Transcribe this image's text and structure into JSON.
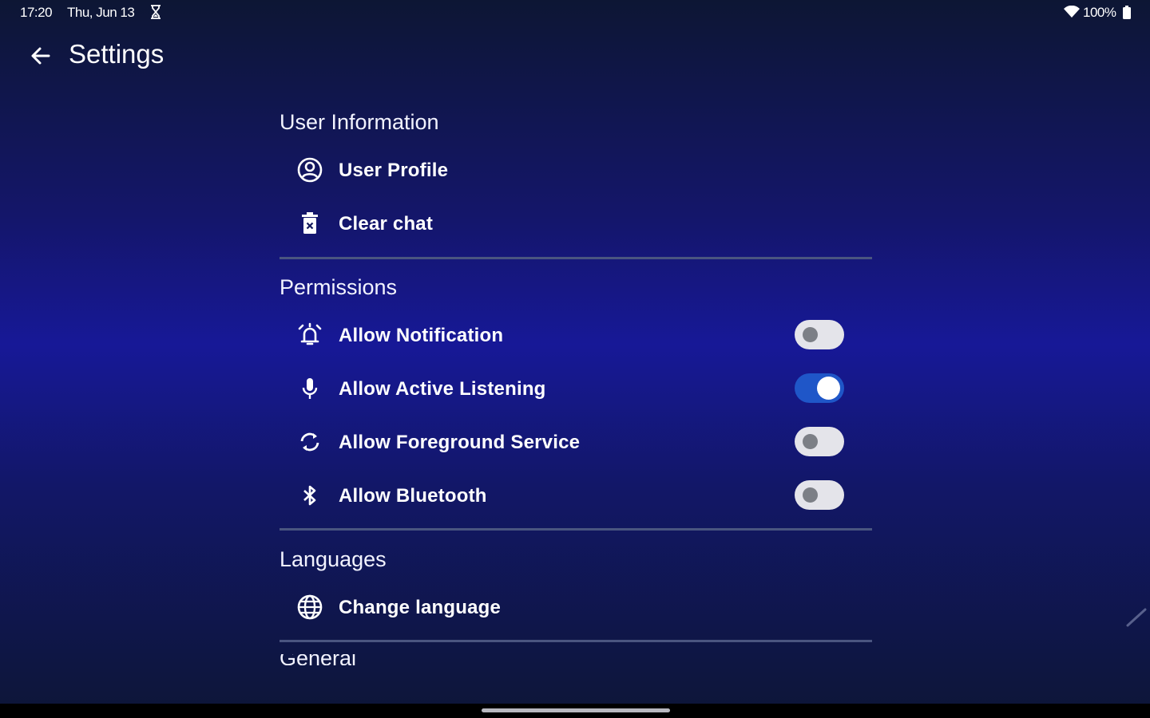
{
  "status_bar": {
    "time": "17:20",
    "date": "Thu, Jun 13",
    "battery": "100%",
    "icons": [
      "hourglass-icon",
      "wifi-icon",
      "battery-icon"
    ]
  },
  "app_bar": {
    "title": "Settings",
    "back_icon": "arrow-back-icon"
  },
  "sections": {
    "user_information": {
      "header": "User Information",
      "items": [
        {
          "label": "User Profile",
          "icon": "account-circle-icon"
        },
        {
          "label": "Clear chat",
          "icon": "delete-icon"
        }
      ]
    },
    "permissions": {
      "header": "Permissions",
      "items": [
        {
          "label": "Allow Notification",
          "icon": "alarm-bell-icon",
          "enabled": false
        },
        {
          "label": "Allow Active Listening",
          "icon": "microphone-icon",
          "enabled": true
        },
        {
          "label": "Allow Foreground Service",
          "icon": "sync-icon",
          "enabled": false
        },
        {
          "label": "Allow Bluetooth",
          "icon": "bluetooth-icon",
          "enabled": false
        }
      ]
    },
    "languages": {
      "header": "Languages",
      "items": [
        {
          "label": "Change language",
          "icon": "globe-icon"
        }
      ]
    },
    "next_section_partial": {
      "header": "General"
    }
  },
  "colors": {
    "background_top": "#0d1634",
    "background_mid": "#171897",
    "toggle_on": "#1f56c8",
    "toggle_off_track": "#e4e4ea",
    "divider": "#4a5580"
  }
}
